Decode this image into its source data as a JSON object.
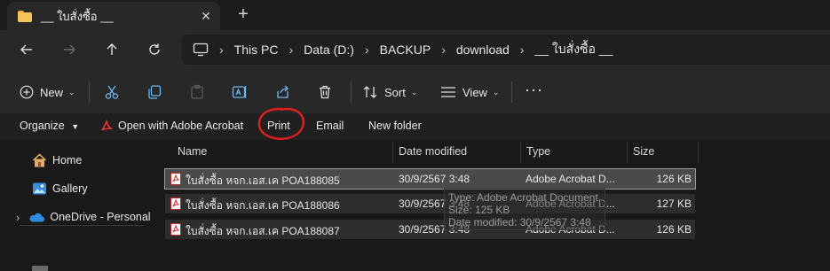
{
  "tab": {
    "title": "__ ใบสั่งซื้อ __",
    "close_glyph": "✕",
    "new_tab_glyph": "+"
  },
  "breadcrumb": [
    "This PC",
    "Data (D:)",
    "BACKUP",
    "download",
    "__ ใบสั่งซื้อ __"
  ],
  "commands": {
    "new_label": "New",
    "sort_label": "Sort",
    "view_label": "View",
    "more_label": "···"
  },
  "menubar": {
    "organize": "Organize",
    "open_with": "Open with Adobe Acrobat",
    "print": "Print",
    "email": "Email",
    "new_folder": "New folder"
  },
  "sidebar": {
    "home": "Home",
    "gallery": "Gallery",
    "onedrive": "OneDrive - Personal"
  },
  "columns": {
    "name": "Name",
    "date_modified": "Date modified",
    "type": "Type",
    "size": "Size"
  },
  "files": [
    {
      "name": "ใบสั่งซื้อ หจก.เอส.เค POA188085",
      "date": "30/9/2567 3:48",
      "type": "Adobe Acrobat D...",
      "size": "126 KB",
      "selected": true
    },
    {
      "name": "ใบสั่งซื้อ หจก.เอส.เค POA188086",
      "date": "30/9/2567 3:48",
      "type": "Adobe Acrobat D...",
      "size": "127 KB",
      "selected": false
    },
    {
      "name": "ใบสั่งซื้อ หจก.เอส.เค POA188087",
      "date": "30/9/2567 3:48",
      "type": "Adobe Acrobat D...",
      "size": "126 KB",
      "selected": false
    }
  ],
  "tooltip": {
    "type": "Type: Adobe Acrobat Document",
    "size": "Size: 125 KB",
    "date": "Date modified: 30/9/2567 3:48"
  },
  "colors": {
    "accent": "#4cc2ff",
    "pdf_red": "#d32f2f",
    "annotation_red": "#e11d1d",
    "folder_yellow": "#f4c55a"
  }
}
